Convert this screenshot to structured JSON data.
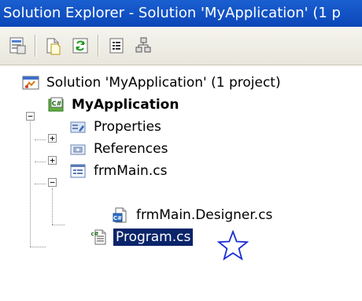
{
  "window": {
    "title": "Solution Explorer - Solution 'MyApplication' (1 p"
  },
  "toolbar": {
    "buttons": [
      {
        "icon": "properties-icon"
      },
      {
        "icon": "show-all-files-icon"
      },
      {
        "icon": "refresh-icon"
      },
      {
        "icon": "view-code-icon"
      },
      {
        "icon": "class-view-icon"
      }
    ]
  },
  "tree": {
    "solution": {
      "label": "Solution 'MyApplication' (1 project)",
      "icon": "solution-icon"
    },
    "project": {
      "label": "MyApplication",
      "icon": "csharp-project-icon",
      "expanded": true
    },
    "properties": {
      "label": "Properties",
      "icon": "properties-folder-icon",
      "expanded": false
    },
    "references": {
      "label": "References",
      "icon": "references-icon",
      "expanded": false
    },
    "frmmain": {
      "label": "frmMain.cs",
      "icon": "form-icon",
      "expanded": true
    },
    "designer": {
      "label": "frmMain.Designer.cs",
      "icon": "csharp-file-icon"
    },
    "program": {
      "label": "Program.cs",
      "icon": "csharp-file-icon",
      "selected": true
    }
  },
  "annotation": {
    "icon": "star-icon",
    "color": "#1a2fd6"
  },
  "colors": {
    "titlebar": "#0b46b8",
    "selection": "#0a246a"
  }
}
